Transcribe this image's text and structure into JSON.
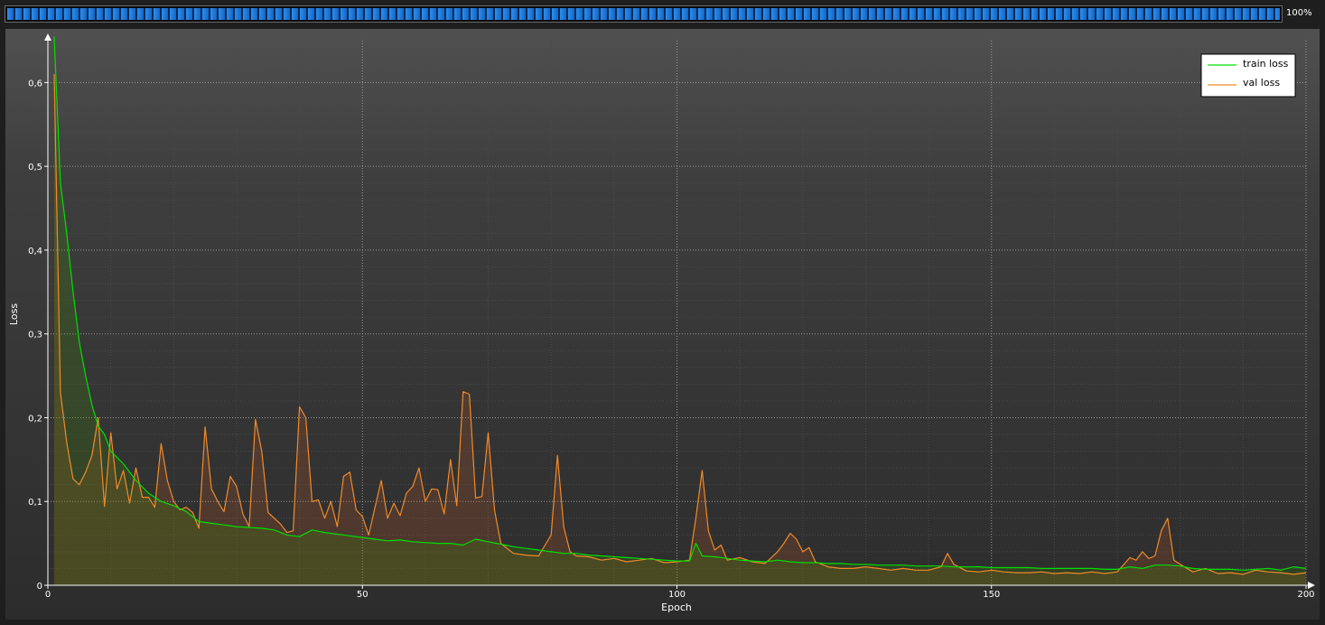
{
  "progress": {
    "label": "100%",
    "fraction": 1.0,
    "color": "#1e7fe0"
  },
  "chart_data": {
    "type": "line",
    "title": "",
    "xlabel": "Epoch",
    "ylabel": "Loss",
    "xlim": [
      0,
      200
    ],
    "ylim": [
      0,
      0.65
    ],
    "xticks": [
      0,
      50,
      100,
      150,
      200
    ],
    "yticks": [
      0,
      0.1,
      0.2,
      0.3,
      0.4,
      0.5,
      0.6
    ],
    "ytick_labels": [
      "0",
      "0,1",
      "0,2",
      "0,3",
      "0,4",
      "0,5",
      "0,6"
    ],
    "grid": true,
    "legend_position": "top-right",
    "series": [
      {
        "name": "train loss",
        "color": "#00e000",
        "points": [
          [
            1,
            0.655
          ],
          [
            2,
            0.48
          ],
          [
            3,
            0.42
          ],
          [
            4,
            0.35
          ],
          [
            5,
            0.29
          ],
          [
            6,
            0.25
          ],
          [
            7,
            0.215
          ],
          [
            8,
            0.19
          ],
          [
            9,
            0.18
          ],
          [
            10,
            0.16
          ],
          [
            12,
            0.145
          ],
          [
            14,
            0.125
          ],
          [
            16,
            0.11
          ],
          [
            18,
            0.1
          ],
          [
            20,
            0.095
          ],
          [
            22,
            0.088
          ],
          [
            24,
            0.076
          ],
          [
            26,
            0.074
          ],
          [
            28,
            0.072
          ],
          [
            30,
            0.07
          ],
          [
            32,
            0.069
          ],
          [
            34,
            0.068
          ],
          [
            36,
            0.066
          ],
          [
            38,
            0.06
          ],
          [
            40,
            0.058
          ],
          [
            42,
            0.066
          ],
          [
            44,
            0.063
          ],
          [
            46,
            0.061
          ],
          [
            48,
            0.059
          ],
          [
            50,
            0.057
          ],
          [
            52,
            0.055
          ],
          [
            54,
            0.053
          ],
          [
            56,
            0.054
          ],
          [
            58,
            0.052
          ],
          [
            60,
            0.051
          ],
          [
            62,
            0.05
          ],
          [
            64,
            0.05
          ],
          [
            66,
            0.048
          ],
          [
            68,
            0.055
          ],
          [
            70,
            0.052
          ],
          [
            72,
            0.049
          ],
          [
            74,
            0.046
          ],
          [
            76,
            0.044
          ],
          [
            78,
            0.042
          ],
          [
            80,
            0.04
          ],
          [
            82,
            0.038
          ],
          [
            84,
            0.038
          ],
          [
            86,
            0.036
          ],
          [
            88,
            0.035
          ],
          [
            90,
            0.034
          ],
          [
            92,
            0.033
          ],
          [
            94,
            0.032
          ],
          [
            96,
            0.031
          ],
          [
            98,
            0.03
          ],
          [
            100,
            0.029
          ],
          [
            102,
            0.029
          ],
          [
            103,
            0.05
          ],
          [
            104,
            0.035
          ],
          [
            106,
            0.034
          ],
          [
            108,
            0.032
          ],
          [
            110,
            0.03
          ],
          [
            112,
            0.029
          ],
          [
            114,
            0.028
          ],
          [
            116,
            0.03
          ],
          [
            118,
            0.028
          ],
          [
            120,
            0.027
          ],
          [
            122,
            0.027
          ],
          [
            124,
            0.026
          ],
          [
            126,
            0.026
          ],
          [
            128,
            0.025
          ],
          [
            130,
            0.025
          ],
          [
            132,
            0.024
          ],
          [
            134,
            0.024
          ],
          [
            136,
            0.024
          ],
          [
            138,
            0.023
          ],
          [
            140,
            0.023
          ],
          [
            142,
            0.023
          ],
          [
            144,
            0.022
          ],
          [
            146,
            0.022
          ],
          [
            148,
            0.022
          ],
          [
            150,
            0.021
          ],
          [
            152,
            0.021
          ],
          [
            154,
            0.021
          ],
          [
            156,
            0.021
          ],
          [
            158,
            0.02
          ],
          [
            160,
            0.02
          ],
          [
            162,
            0.02
          ],
          [
            164,
            0.02
          ],
          [
            166,
            0.02
          ],
          [
            168,
            0.019
          ],
          [
            170,
            0.019
          ],
          [
            172,
            0.022
          ],
          [
            174,
            0.02
          ],
          [
            176,
            0.024
          ],
          [
            178,
            0.024
          ],
          [
            180,
            0.023
          ],
          [
            182,
            0.02
          ],
          [
            184,
            0.019
          ],
          [
            186,
            0.019
          ],
          [
            188,
            0.019
          ],
          [
            190,
            0.018
          ],
          [
            192,
            0.019
          ],
          [
            194,
            0.02
          ],
          [
            196,
            0.018
          ],
          [
            198,
            0.022
          ],
          [
            200,
            0.02
          ]
        ]
      },
      {
        "name": "val loss",
        "color": "#f08a2a",
        "points": [
          [
            1,
            0.61
          ],
          [
            2,
            0.23
          ],
          [
            3,
            0.17
          ],
          [
            4,
            0.127
          ],
          [
            5,
            0.12
          ],
          [
            6,
            0.135
          ],
          [
            7,
            0.155
          ],
          [
            8,
            0.2
          ],
          [
            9,
            0.094
          ],
          [
            10,
            0.182
          ],
          [
            11,
            0.115
          ],
          [
            12,
            0.137
          ],
          [
            13,
            0.098
          ],
          [
            14,
            0.14
          ],
          [
            15,
            0.105
          ],
          [
            16,
            0.105
          ],
          [
            17,
            0.093
          ],
          [
            18,
            0.169
          ],
          [
            19,
            0.125
          ],
          [
            20,
            0.1
          ],
          [
            21,
            0.09
          ],
          [
            22,
            0.093
          ],
          [
            23,
            0.087
          ],
          [
            24,
            0.068
          ],
          [
            25,
            0.189
          ],
          [
            26,
            0.115
          ],
          [
            27,
            0.1
          ],
          [
            28,
            0.088
          ],
          [
            29,
            0.13
          ],
          [
            30,
            0.118
          ],
          [
            31,
            0.085
          ],
          [
            32,
            0.07
          ],
          [
            33,
            0.198
          ],
          [
            34,
            0.16
          ],
          [
            35,
            0.087
          ],
          [
            36,
            0.08
          ],
          [
            37,
            0.073
          ],
          [
            38,
            0.063
          ],
          [
            39,
            0.065
          ],
          [
            40,
            0.213
          ],
          [
            41,
            0.2
          ],
          [
            42,
            0.1
          ],
          [
            43,
            0.102
          ],
          [
            44,
            0.08
          ],
          [
            45,
            0.1
          ],
          [
            46,
            0.07
          ],
          [
            47,
            0.13
          ],
          [
            48,
            0.135
          ],
          [
            49,
            0.09
          ],
          [
            50,
            0.082
          ],
          [
            51,
            0.06
          ],
          [
            52,
            0.093
          ],
          [
            53,
            0.125
          ],
          [
            54,
            0.08
          ],
          [
            55,
            0.098
          ],
          [
            56,
            0.083
          ],
          [
            57,
            0.11
          ],
          [
            58,
            0.118
          ],
          [
            59,
            0.14
          ],
          [
            60,
            0.1
          ],
          [
            61,
            0.115
          ],
          [
            62,
            0.114
          ],
          [
            63,
            0.085
          ],
          [
            64,
            0.15
          ],
          [
            65,
            0.095
          ],
          [
            66,
            0.231
          ],
          [
            67,
            0.228
          ],
          [
            68,
            0.104
          ],
          [
            69,
            0.106
          ],
          [
            70,
            0.182
          ],
          [
            71,
            0.09
          ],
          [
            72,
            0.05
          ],
          [
            74,
            0.038
          ],
          [
            76,
            0.036
          ],
          [
            78,
            0.035
          ],
          [
            80,
            0.06
          ],
          [
            81,
            0.155
          ],
          [
            82,
            0.07
          ],
          [
            83,
            0.04
          ],
          [
            84,
            0.035
          ],
          [
            86,
            0.034
          ],
          [
            88,
            0.03
          ],
          [
            90,
            0.032
          ],
          [
            92,
            0.028
          ],
          [
            94,
            0.03
          ],
          [
            96,
            0.032
          ],
          [
            98,
            0.027
          ],
          [
            100,
            0.028
          ],
          [
            102,
            0.03
          ],
          [
            103,
            0.08
          ],
          [
            104,
            0.137
          ],
          [
            105,
            0.065
          ],
          [
            106,
            0.042
          ],
          [
            107,
            0.048
          ],
          [
            108,
            0.03
          ],
          [
            110,
            0.033
          ],
          [
            112,
            0.028
          ],
          [
            114,
            0.026
          ],
          [
            116,
            0.04
          ],
          [
            117,
            0.05
          ],
          [
            118,
            0.062
          ],
          [
            119,
            0.055
          ],
          [
            120,
            0.04
          ],
          [
            121,
            0.045
          ],
          [
            122,
            0.028
          ],
          [
            124,
            0.022
          ],
          [
            126,
            0.02
          ],
          [
            128,
            0.02
          ],
          [
            130,
            0.022
          ],
          [
            132,
            0.02
          ],
          [
            134,
            0.018
          ],
          [
            136,
            0.02
          ],
          [
            138,
            0.018
          ],
          [
            140,
            0.018
          ],
          [
            142,
            0.022
          ],
          [
            143,
            0.038
          ],
          [
            144,
            0.025
          ],
          [
            146,
            0.017
          ],
          [
            148,
            0.016
          ],
          [
            150,
            0.018
          ],
          [
            152,
            0.016
          ],
          [
            154,
            0.015
          ],
          [
            156,
            0.015
          ],
          [
            158,
            0.016
          ],
          [
            160,
            0.014
          ],
          [
            162,
            0.015
          ],
          [
            164,
            0.014
          ],
          [
            166,
            0.016
          ],
          [
            168,
            0.014
          ],
          [
            170,
            0.016
          ],
          [
            172,
            0.033
          ],
          [
            173,
            0.03
          ],
          [
            174,
            0.04
          ],
          [
            175,
            0.032
          ],
          [
            176,
            0.035
          ],
          [
            177,
            0.065
          ],
          [
            178,
            0.08
          ],
          [
            179,
            0.03
          ],
          [
            180,
            0.025
          ],
          [
            182,
            0.016
          ],
          [
            184,
            0.02
          ],
          [
            186,
            0.014
          ],
          [
            188,
            0.015
          ],
          [
            190,
            0.013
          ],
          [
            192,
            0.018
          ],
          [
            194,
            0.016
          ],
          [
            196,
            0.015
          ],
          [
            198,
            0.013
          ],
          [
            200,
            0.015
          ]
        ]
      }
    ]
  }
}
